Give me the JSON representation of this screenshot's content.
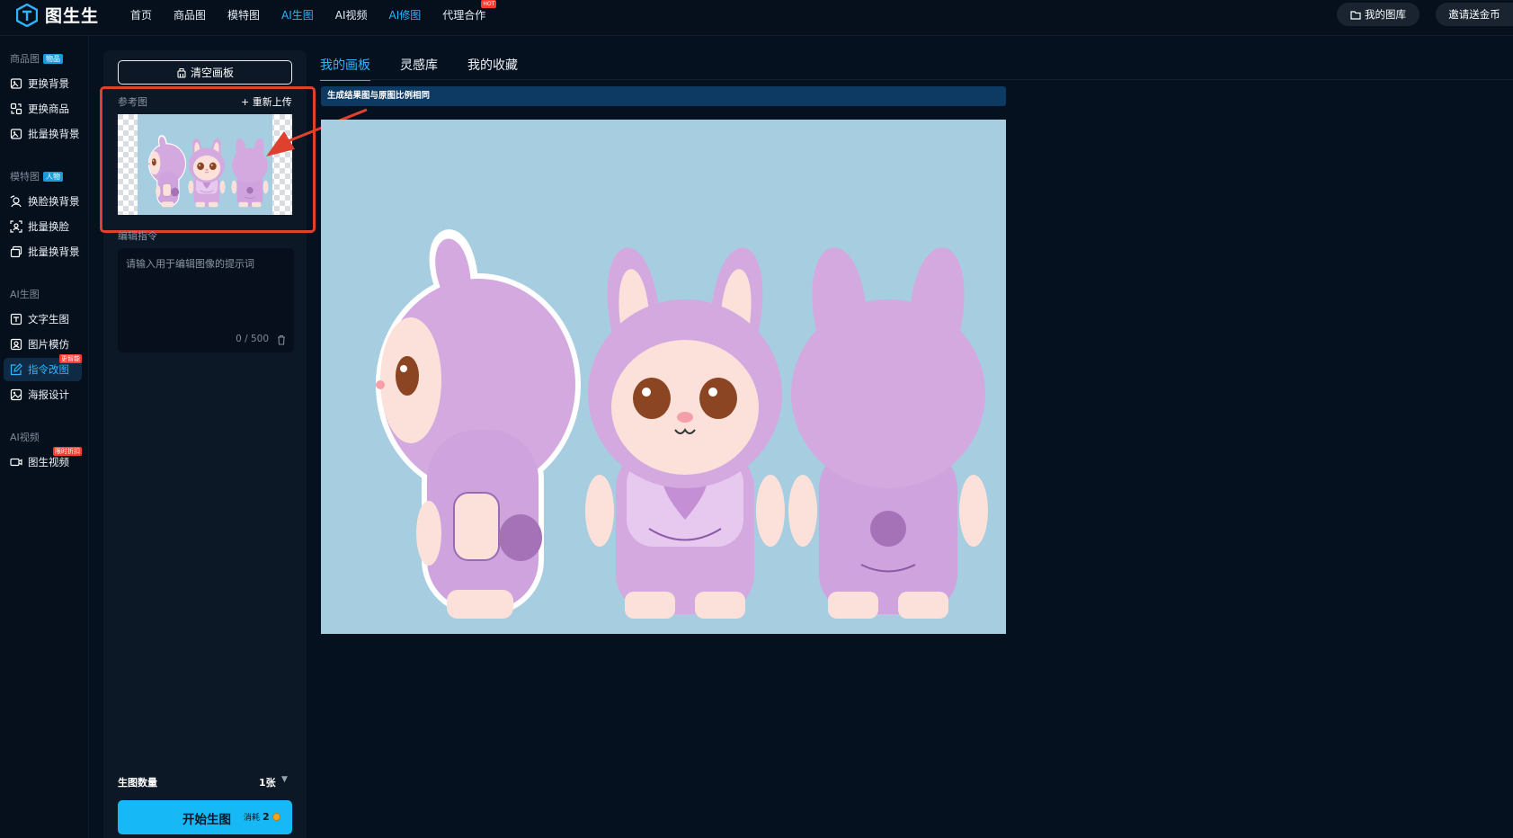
{
  "app": {
    "name": "图生生"
  },
  "nav": {
    "items": [
      {
        "label": "首页",
        "active": false
      },
      {
        "label": "商品图",
        "active": false
      },
      {
        "label": "模特图",
        "active": false
      },
      {
        "label": "AI生图",
        "active": true
      },
      {
        "label": "AI视频",
        "active": false
      },
      {
        "label": "AI修图",
        "active": true
      },
      {
        "label": "代理合作",
        "active": false,
        "badge": "HOT"
      }
    ],
    "my_gallery": "我的图库",
    "invite": "邀请送金币"
  },
  "sidebar": {
    "groups": [
      {
        "title": "商品图",
        "badge": "物品",
        "items": [
          {
            "label": "更换背景",
            "icon": "image-swap-icon"
          },
          {
            "label": "更换商品",
            "icon": "product-swap-icon"
          },
          {
            "label": "批量换背景",
            "icon": "batch-background-icon"
          }
        ]
      },
      {
        "title": "模特图",
        "badge": "人物",
        "items": [
          {
            "label": "换脸换背景",
            "icon": "face-swap-icon"
          },
          {
            "label": "批量换脸",
            "icon": "batch-face-icon"
          },
          {
            "label": "批量换背景",
            "icon": "batch-background-icon"
          }
        ]
      },
      {
        "title": "AI生图",
        "badge": "",
        "items": [
          {
            "label": "文字生图",
            "icon": "text-image-icon"
          },
          {
            "label": "图片模仿",
            "icon": "image-imitate-icon"
          },
          {
            "label": "指令改图",
            "icon": "edit-command-icon",
            "active": true,
            "badge": "更智能"
          },
          {
            "label": "海报设计",
            "icon": "poster-icon"
          }
        ]
      },
      {
        "title": "AI视频",
        "badge": "",
        "items": [
          {
            "label": "图生视频",
            "icon": "video-icon",
            "badge": "限时折扣"
          }
        ]
      }
    ]
  },
  "panel": {
    "clear_label": "清空画板",
    "ref_label": "参考图",
    "reupload_label": "+ 重新上传",
    "command_label": "编辑指令",
    "prompt_placeholder": "请输入用于编辑图像的提示词",
    "counter": "0 / 500",
    "count_label": "生图数量",
    "count_value": "1张",
    "generate_label": "开始生图",
    "cost_label": "消耗",
    "cost_value": "2"
  },
  "canvas": {
    "tabs": [
      {
        "label": "我的画板",
        "active": true
      },
      {
        "label": "灵感库",
        "active": false
      },
      {
        "label": "我的收藏",
        "active": false
      }
    ],
    "notice": "生成结果图与原图比例相同"
  },
  "colors": {
    "accent": "#29b7ff",
    "highlight": "#e0412e",
    "bunny": "#d4a9df",
    "canvas_bg": "#a6cde0"
  }
}
